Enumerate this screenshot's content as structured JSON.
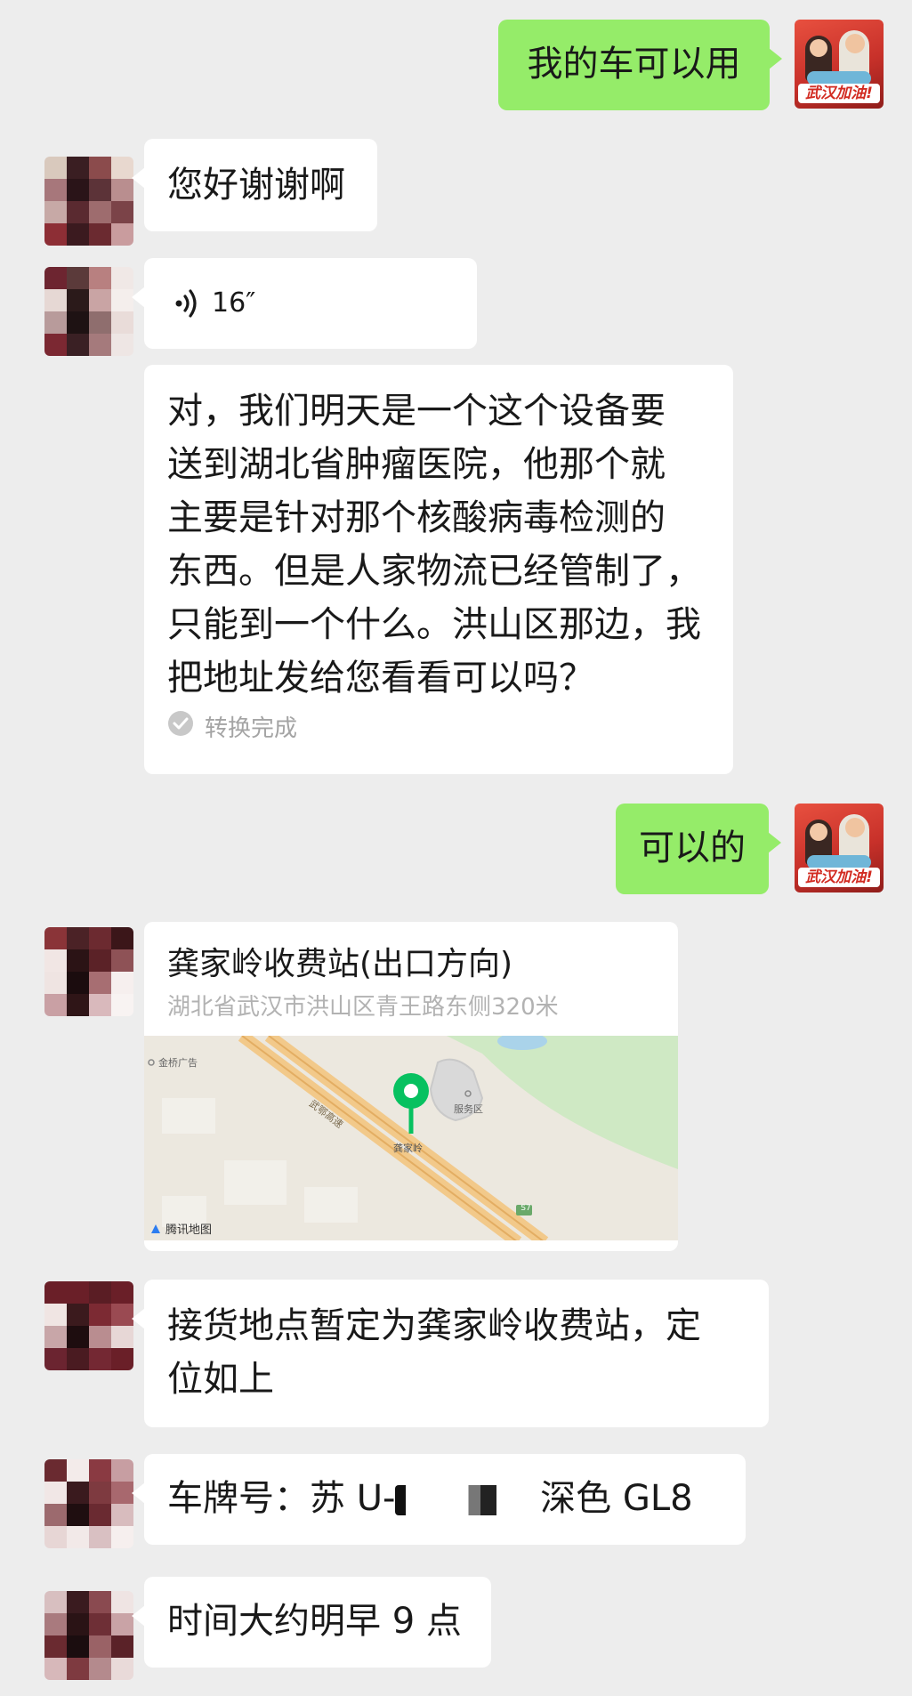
{
  "messages": {
    "m1": "我的车可以用",
    "m2": "您好谢谢啊",
    "m3_voice_duration": "16″",
    "m4_transcript_lines": [
      "对，我们明天是一个这个设备要",
      "送到湖北省肿瘤医院，他那个就",
      "主要是针对那个核酸病毒检测的",
      "东西。但是人家物流已经管制了，",
      "只能到一个什么。洪山区那边，我",
      "把地址发给您看看可以吗？"
    ],
    "m4_status": "转换完成",
    "m5": "可以的",
    "m6_location": {
      "name": "龚家岭收费站(出口方向)",
      "address": "湖北省武汉市洪山区青王路东侧320米",
      "map_labels": {
        "poi1": "金桥广告",
        "road": "武鄂高速",
        "service": "服务区",
        "place": "龚家岭",
        "highway": "S7",
        "brand": "腾讯地图"
      }
    },
    "m7_lines": [
      "接货地点暂定为龚家岭收费站，定",
      "位如上"
    ],
    "m8_prefix": "车牌号：苏 U-",
    "m8_suffix": "深色 GL8",
    "m9": "时间大约明早 9 点"
  },
  "avatar_tag": "武汉加油!",
  "colors": {
    "sent_bubble": "#95ec69",
    "received_bubble": "#ffffff",
    "background": "#ededed",
    "map_pin": "#07c160"
  }
}
